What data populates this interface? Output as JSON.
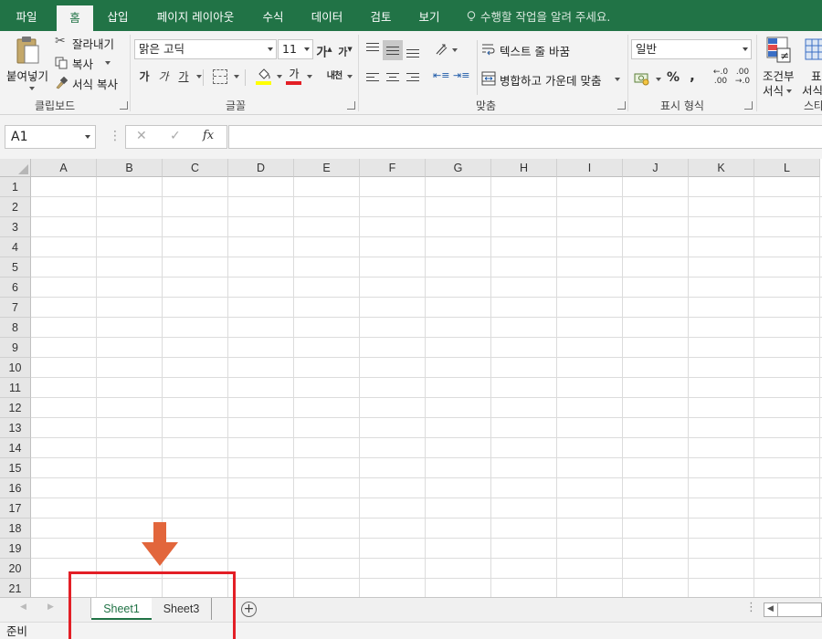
{
  "ribbon_tabs": [
    "파일",
    "홈",
    "삽입",
    "페이지 레이아웃",
    "수식",
    "데이터",
    "검토",
    "보기"
  ],
  "active_tab": "홈",
  "tell_me": "수행할 작업을 알려 주세요.",
  "clipboard": {
    "paste": "붙여넣기",
    "cut": "잘라내기",
    "copy": "복사",
    "format_painter": "서식 복사",
    "label": "클립보드"
  },
  "font": {
    "name": "맑은 고딕",
    "size": "11",
    "bold": "가",
    "italic": "가",
    "underline": "가",
    "grow": "가",
    "shrink": "가",
    "font_color": "가",
    "phonetic": "내천",
    "label": "글꼴"
  },
  "alignment": {
    "wrap_text": "텍스트 줄 바꿈",
    "merge_center": "병합하고 가운데 맞춤",
    "label": "맞춤"
  },
  "number": {
    "format": "일반",
    "percent": "%",
    "comma": ",",
    "label": "표시 형식"
  },
  "styles": {
    "conditional_line1": "조건부",
    "conditional_line2": "서식",
    "table_line1": "표",
    "table_line2": "서식",
    "label": "스타"
  },
  "formula_bar": {
    "name_box": "A1",
    "cancel": "✕",
    "enter": "✓",
    "fx": "fx",
    "value": ""
  },
  "columns": [
    "A",
    "B",
    "C",
    "D",
    "E",
    "F",
    "G",
    "H",
    "I",
    "J",
    "K",
    "L"
  ],
  "rows": [
    "1",
    "2",
    "3",
    "4",
    "5",
    "6",
    "7",
    "8",
    "9",
    "10",
    "11",
    "12",
    "13",
    "14",
    "15",
    "16",
    "17",
    "18",
    "19",
    "20",
    "21"
  ],
  "sheets": [
    {
      "name": "Sheet1",
      "active": true
    },
    {
      "name": "Sheet3",
      "active": false
    }
  ],
  "add_sheet": "+",
  "status": "준비",
  "colors": {
    "brand": "#217346",
    "highlight_box": "#e31f26",
    "arrow": "#e2663c",
    "fill_yellow": "#ffff00",
    "font_red": "#e31f26"
  }
}
